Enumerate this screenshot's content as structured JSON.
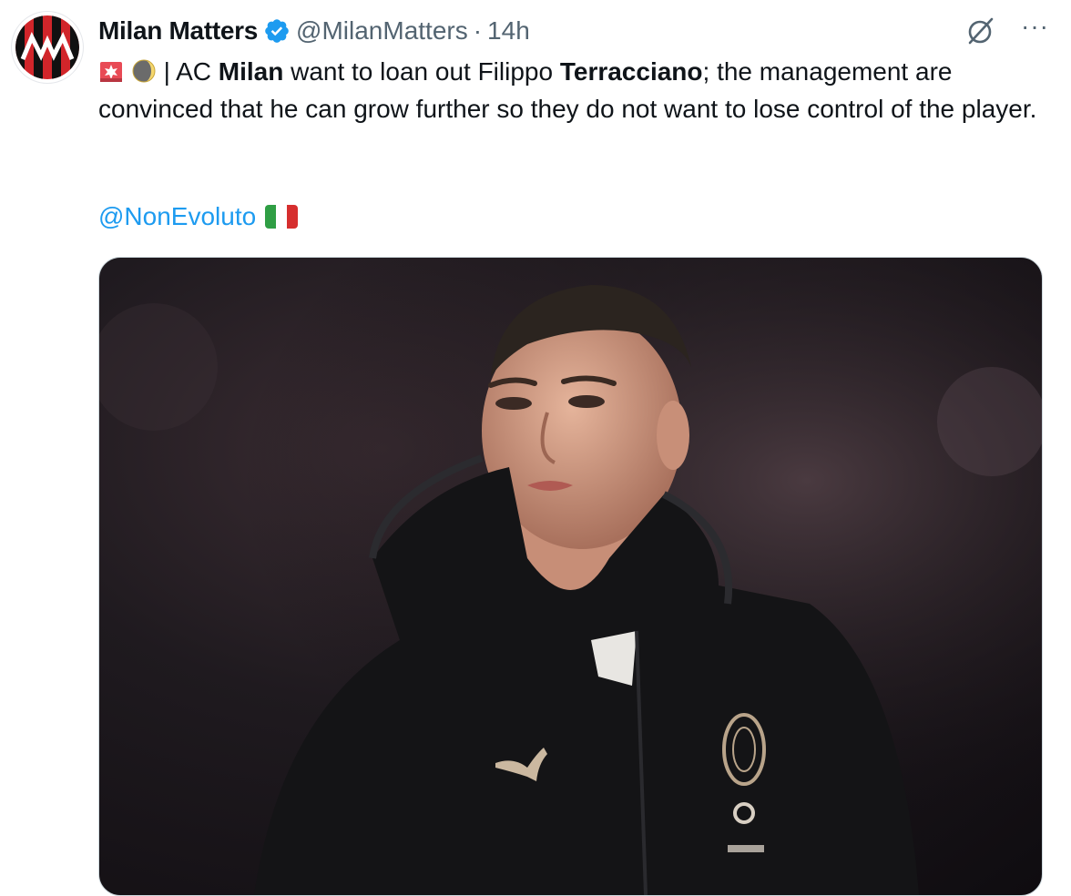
{
  "tweet": {
    "author_name": "Milan Matters",
    "handle": "@MilanMatters",
    "separator": "·",
    "time": "14h",
    "more_label": "···",
    "text": {
      "pre_divider": "|",
      "part1": "AC ",
      "bold1": "Milan",
      "part2": " want to loan out Filippo ",
      "bold2": "Terracciano",
      "part3": "; the management are convinced that he can grow further so they do not want to lose control of the player."
    },
    "mention": "@NonEvoluto"
  },
  "icons": {
    "avatar": "milan-matters-logo",
    "verified": "verified-badge-icon",
    "grok": "grok-icon",
    "more": "more-icon",
    "siren": "siren-emoji",
    "moon": "moon-emoji",
    "flag": "italy-flag-emoji"
  },
  "colors": {
    "link": "#1d9bf0",
    "muted": "#536471",
    "text": "#0f1419",
    "verified": "#1d9bf0"
  }
}
